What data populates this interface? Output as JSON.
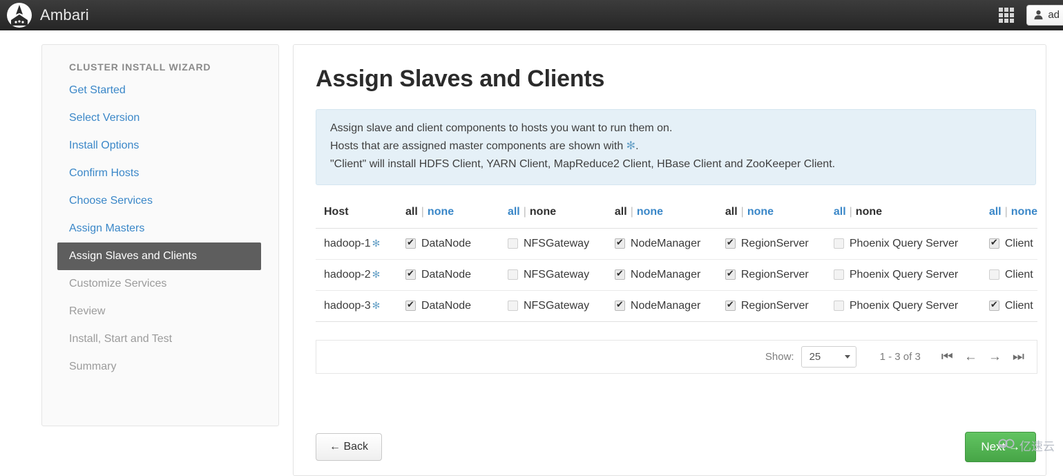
{
  "navbar": {
    "brand": "Ambari",
    "grid_icon": "grid-apps-icon",
    "user_icon": "user-icon",
    "user_label": "ad"
  },
  "sidebar": {
    "title": "CLUSTER INSTALL WIZARD",
    "items": [
      {
        "label": "Get Started",
        "state": "link"
      },
      {
        "label": "Select Version",
        "state": "link"
      },
      {
        "label": "Install Options",
        "state": "link"
      },
      {
        "label": "Confirm Hosts",
        "state": "link"
      },
      {
        "label": "Choose Services",
        "state": "link"
      },
      {
        "label": "Assign Masters",
        "state": "link"
      },
      {
        "label": "Assign Slaves and Clients",
        "state": "active"
      },
      {
        "label": "Customize Services",
        "state": "muted"
      },
      {
        "label": "Review",
        "state": "muted"
      },
      {
        "label": "Install, Start and Test",
        "state": "muted"
      },
      {
        "label": "Summary",
        "state": "muted"
      }
    ]
  },
  "main": {
    "title": "Assign Slaves and Clients",
    "info": {
      "line1": "Assign slave and client components to hosts you want to run them on.",
      "line2_pre": "Hosts that are assigned master components are shown with ",
      "line2_star": "✻",
      "line2_post": ".",
      "line3": "\"Client\" will install HDFS Client, YARN Client, MapReduce2 Client, HBase Client and ZooKeeper Client."
    },
    "table": {
      "host_header": "Host",
      "all_label": "all",
      "none_label": "none",
      "separator": "|",
      "columns": [
        {
          "component": "DataNode",
          "all_active": false,
          "none_active": true
        },
        {
          "component": "NFSGateway",
          "all_active": true,
          "none_active": false
        },
        {
          "component": "NodeManager",
          "all_active": false,
          "none_active": true
        },
        {
          "component": "RegionServer",
          "all_active": false,
          "none_active": true
        },
        {
          "component": "Phoenix Query Server",
          "all_active": true,
          "none_active": false
        },
        {
          "component": "Client",
          "all_active": true,
          "none_active": true
        }
      ],
      "rows": [
        {
          "host": "hadoop-1",
          "master_marker": "✻",
          "checks": [
            true,
            false,
            true,
            true,
            false,
            true
          ]
        },
        {
          "host": "hadoop-2",
          "master_marker": "✻",
          "checks": [
            true,
            false,
            true,
            true,
            false,
            false
          ]
        },
        {
          "host": "hadoop-3",
          "master_marker": "✻",
          "checks": [
            true,
            false,
            true,
            true,
            false,
            true
          ]
        }
      ]
    },
    "pagination": {
      "show_label": "Show:",
      "page_size": "25",
      "range_text": "1 - 3 of 3",
      "first_icon": "first-page-icon",
      "prev_icon": "prev-page-icon",
      "next_icon": "next-page-icon",
      "last_icon": "last-page-icon",
      "first_glyph": "⏮",
      "prev_glyph": "←",
      "next_glyph": "→",
      "last_glyph": "⏭"
    },
    "buttons": {
      "back": "← Back",
      "next": "Next →"
    }
  },
  "watermark": {
    "text": "亿速云"
  }
}
